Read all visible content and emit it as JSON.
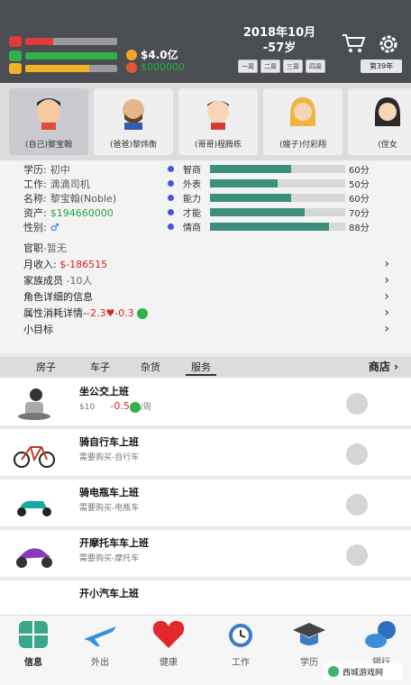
{
  "header": {
    "date_line1": "2018年10月",
    "date_line2": "-57岁",
    "money": "$4.0亿",
    "money2": "$000000",
    "health_pct": 30,
    "happy_pct": 100,
    "energy_pct": 70,
    "time_buttons": [
      "一周",
      "二周",
      "三周",
      "四周"
    ],
    "year_button": "第39年",
    "colors": {
      "health": "#e03a3a",
      "happy": "#2fb24a",
      "energy": "#f0b326"
    }
  },
  "avatars": [
    {
      "name": "(自己)黎宝翰"
    },
    {
      "name": "(爸爸)黎炜衡"
    },
    {
      "name": "(哥哥)程腾栋"
    },
    {
      "name": "(嫂子)付彩翔"
    },
    {
      "name": "(侄女"
    }
  ],
  "profile": {
    "education_label": "学历:",
    "education": "初中",
    "job_label": "工作:",
    "job": "滴滴司机",
    "name_label": "名称:",
    "name": "黎宝翰(Noble)",
    "assets_label": "资产:",
    "assets": "$194660000",
    "gender_label": "性别:",
    "gender": "♂"
  },
  "attributes": [
    {
      "label": "智商",
      "score": "60分",
      "value": 60
    },
    {
      "label": "外表",
      "score": "50分",
      "value": 50
    },
    {
      "label": "能力",
      "score": "60分",
      "value": 60
    },
    {
      "label": "才能",
      "score": "70分",
      "value": 70
    },
    {
      "label": "情商",
      "score": "88分",
      "value": 88
    }
  ],
  "links": {
    "official": "官职",
    "official_val": "-暂无",
    "income": "月收入:",
    "income_val": "$-186515",
    "family": "家族成员",
    "family_val": "-10人",
    "role_detail": "角色详细的信息",
    "attr_cost": "属性消耗详情-",
    "attr_cost_health": "-2.3",
    "attr_cost_happy": "-0.3",
    "goal": "小目标"
  },
  "tabs": [
    "房子",
    "车子",
    "杂货",
    "服务"
  ],
  "shop": "商店",
  "items": [
    {
      "title": "坐公交上班",
      "price": "$10",
      "cost": "-0.5",
      "unit": "/周"
    },
    {
      "title": "骑自行车上班",
      "sub": "需要购买-自行车"
    },
    {
      "title": "骑电瓶车上班",
      "sub": "需要购买-电瓶车"
    },
    {
      "title": "开摩托车车上班",
      "sub": "需要购买-摩托车"
    },
    {
      "title": "开小汽车上班"
    }
  ],
  "nav": [
    "信息",
    "外出",
    "健康",
    "工作",
    "学历",
    "银行"
  ],
  "watermark": "西城游戏网"
}
